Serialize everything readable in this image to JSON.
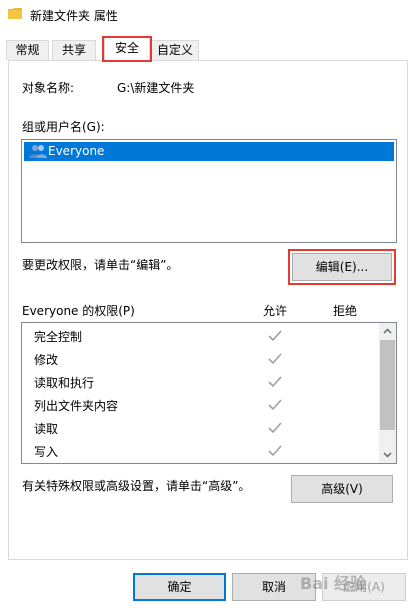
{
  "window": {
    "title": "新建文件夹 属性"
  },
  "tabs": [
    {
      "label": "常规"
    },
    {
      "label": "共享"
    },
    {
      "label": "安全"
    },
    {
      "label": "自定义"
    }
  ],
  "object": {
    "label": "对象名称:",
    "value": "G:\\新建文件夹"
  },
  "groups": {
    "label": "组或用户名(G):",
    "items": [
      {
        "name": "Everyone"
      }
    ]
  },
  "edit": {
    "hint": "要更改权限，请单击“编辑”。",
    "button": "编辑(E)..."
  },
  "permissions": {
    "label": "Everyone 的权限(P)",
    "allow_header": "允许",
    "deny_header": "拒绝",
    "items": [
      {
        "name": "完全控制",
        "allow": true,
        "deny": false
      },
      {
        "name": "修改",
        "allow": true,
        "deny": false
      },
      {
        "name": "读取和执行",
        "allow": true,
        "deny": false
      },
      {
        "name": "列出文件夹内容",
        "allow": true,
        "deny": false
      },
      {
        "name": "读取",
        "allow": true,
        "deny": false
      },
      {
        "name": "写入",
        "allow": true,
        "deny": false
      }
    ]
  },
  "advanced": {
    "hint": "有关特殊权限或高级设置，请单击“高级”。",
    "button": "高级(V)"
  },
  "footer": {
    "ok": "确定",
    "cancel": "取消",
    "apply": "应用(A)"
  },
  "watermark": {
    "text": "Bai 经验"
  },
  "colors": {
    "selection": "#0078d7",
    "highlight": "#e53935",
    "check": "#a0a0a0"
  }
}
